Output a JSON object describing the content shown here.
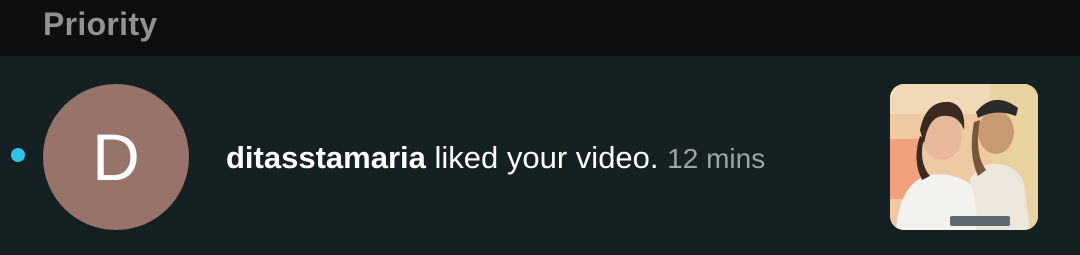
{
  "section": {
    "title": "Priority"
  },
  "notification": {
    "unread": true,
    "avatar_letter": "D",
    "avatar_color": "#98736b",
    "username": "ditasstamaria",
    "action_text": "liked your video.",
    "timestamp": "12 mins",
    "thumbnail_icon": "video-thumbnail"
  },
  "colors": {
    "background": "#142022",
    "header_background": "#0e0e0e",
    "unread_dot": "#2ec3e6",
    "muted_text": "#9ea3a4"
  }
}
